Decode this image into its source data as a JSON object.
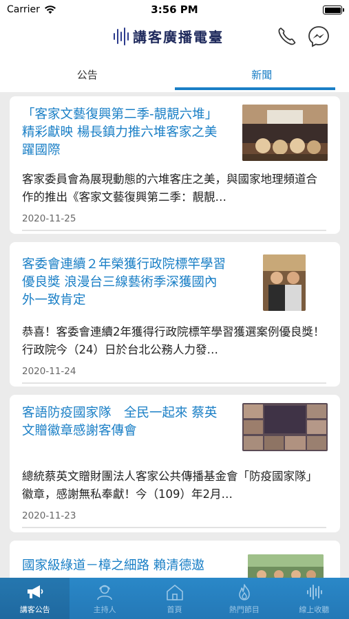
{
  "status_bar": {
    "carrier": "Carrier",
    "time": "3:56 PM"
  },
  "header": {
    "logo_text": "講客廣播電臺"
  },
  "tabs": [
    {
      "label": "公告",
      "active": false
    },
    {
      "label": "新聞",
      "active": true
    }
  ],
  "articles": [
    {
      "title": "「客家文藝復興第二季-靚靚六堆」精彩獻映 楊長鎮力推六堆客家之美躍國際",
      "description": "客家委員會為展現動態的六堆客庄之美，與國家地理頻道合作的推出《客家文藝復興第二季：靚靚…",
      "date": "2020-11-25"
    },
    {
      "title": "客委會連續２年榮獲行政院標竿學習優良獎 浪漫台三線藝術季深獲國內外一致肯定",
      "description": "恭喜！客委會連續2年獲得行政院標竿學習獲選案例優良獎！ 行政院今（24）日於台北公務人力發…",
      "date": "2020-11-24"
    },
    {
      "title": "客語防疫國家隊　全民一起來 蔡英文贈徽章感謝客傳會",
      "description": "總統蔡英文贈財團法人客家公共傳播基金會「防疫國家隊」徽章，感謝無私奉獻！今（109）年2月…",
      "date": "2020-11-23"
    },
    {
      "title": "國家級綠道－樟之細路 賴清德遨",
      "description": "",
      "date": ""
    }
  ],
  "bottom_nav": [
    {
      "label": "講客公告",
      "icon": "megaphone-icon",
      "active": true
    },
    {
      "label": "主持人",
      "icon": "hosts-icon",
      "active": false
    },
    {
      "label": "首頁",
      "icon": "home-icon",
      "active": false
    },
    {
      "label": "熱門節目",
      "icon": "flame-icon",
      "active": false
    },
    {
      "label": "線上收聽",
      "icon": "soundwave-icon",
      "active": false
    }
  ],
  "colors": {
    "accent": "#1a7fc6",
    "nav_bg": "#2a88c8",
    "logo": "#2b3a8c"
  }
}
